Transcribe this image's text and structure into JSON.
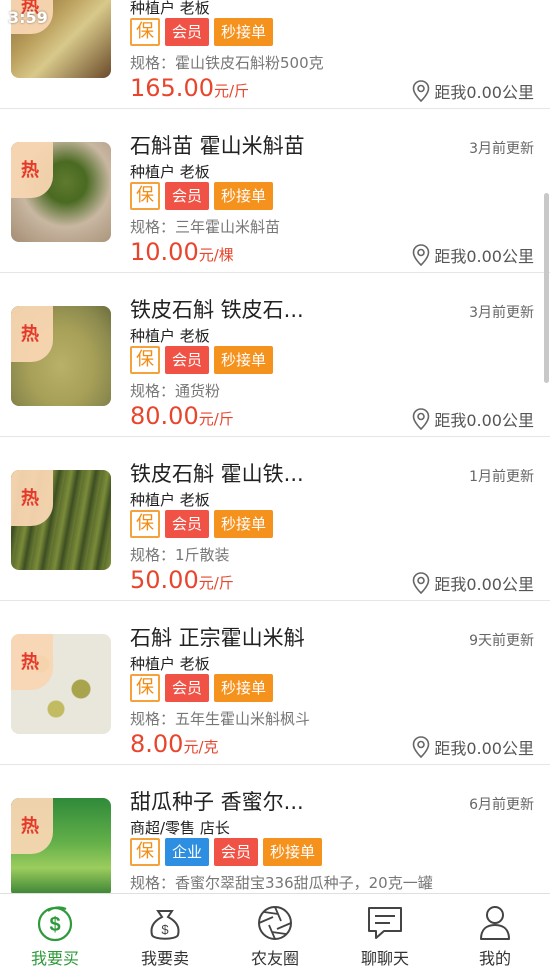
{
  "status_bar": {
    "time": "3:59"
  },
  "colors": {
    "accent_green": "#2e9a3a",
    "price_red": "#e8452d",
    "vip_red": "#f05346",
    "fast_orange": "#f5921e",
    "enterprise_blue": "#2d8ee2"
  },
  "hot_badge": "热",
  "cards": [
    {
      "title": "",
      "updated": "",
      "seller": "种植户 老板",
      "tags": {
        "bao": "保",
        "vip": "会员",
        "fast": "秒接单"
      },
      "spec": "规格：霍山铁皮石斛粉500克",
      "price": "165.00",
      "unit": "元/斤",
      "distance": "距我0.00公里"
    },
    {
      "title": "石斛苗 霍山米斛苗",
      "updated": "3月前更新",
      "seller": "种植户 老板",
      "tags": {
        "bao": "保",
        "vip": "会员",
        "fast": "秒接单"
      },
      "spec": "规格：三年霍山米斛苗",
      "price": "10.00",
      "unit": "元/棵",
      "distance": "距我0.00公里"
    },
    {
      "title": "铁皮石斛 铁皮石...",
      "updated": "3月前更新",
      "seller": "种植户 老板",
      "tags": {
        "bao": "保",
        "vip": "会员",
        "fast": "秒接单"
      },
      "spec": "规格：通货粉",
      "price": "80.00",
      "unit": "元/斤",
      "distance": "距我0.00公里"
    },
    {
      "title": "铁皮石斛 霍山铁...",
      "updated": "1月前更新",
      "seller": "种植户 老板",
      "tags": {
        "bao": "保",
        "vip": "会员",
        "fast": "秒接单"
      },
      "spec": "规格：1斤散装",
      "price": "50.00",
      "unit": "元/斤",
      "distance": "距我0.00公里"
    },
    {
      "title": "石斛 正宗霍山米斛",
      "updated": "9天前更新",
      "seller": "种植户 老板",
      "tags": {
        "bao": "保",
        "vip": "会员",
        "fast": "秒接单"
      },
      "spec": "规格：五年生霍山米斛枫斗",
      "price": "8.00",
      "unit": "元/克",
      "distance": "距我0.00公里"
    },
    {
      "title": "甜瓜种子 香蜜尔...",
      "updated": "6月前更新",
      "seller": "商超/零售 店长",
      "tags": {
        "bao": "保",
        "biz": "企业",
        "vip": "会员",
        "fast": "秒接单"
      },
      "spec": "规格：香蜜尔翠甜宝336甜瓜种子，20克一罐",
      "price": "",
      "unit": "",
      "distance": ""
    }
  ],
  "tabbar": [
    {
      "label": "我要买",
      "icon": "dollar-coin-icon",
      "active": true
    },
    {
      "label": "我要卖",
      "icon": "money-bag-icon",
      "active": false
    },
    {
      "label": "农友圈",
      "icon": "aperture-icon",
      "active": false
    },
    {
      "label": "聊聊天",
      "icon": "chat-bubble-icon",
      "active": false
    },
    {
      "label": "我的",
      "icon": "person-icon",
      "active": false
    }
  ]
}
